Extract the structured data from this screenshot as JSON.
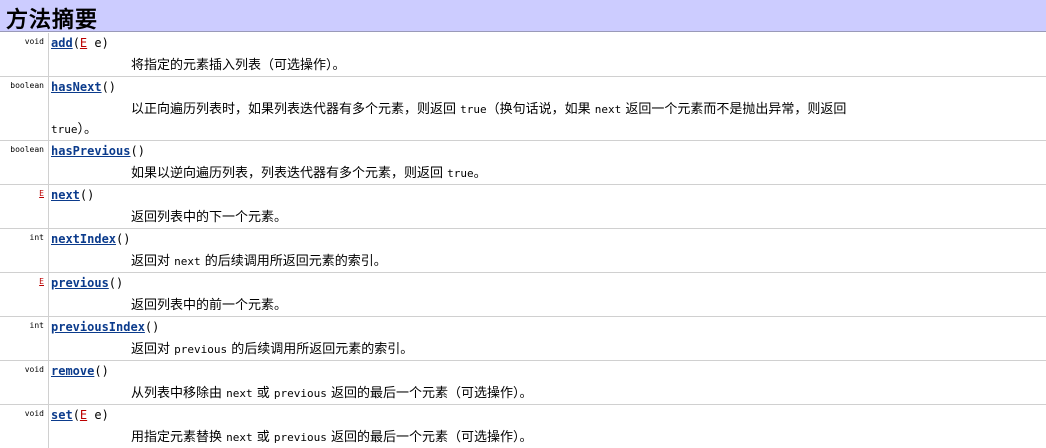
{
  "header": {
    "title": "方法摘要"
  },
  "methods": [
    {
      "ret": "void",
      "name": "add",
      "p_open": "(",
      "tparam": "E",
      "p_rest": " e)",
      "desc": "将指定的元素插入列表（可选操作）。"
    },
    {
      "ret": "boolean",
      "name": "hasNext",
      "p_open": "()",
      "desc_a": "以正向遍历列表时，如果列表迭代器有多个元素，则返回 ",
      "code_a": "true",
      "desc_b": "（换句话说，如果 ",
      "code_b": "next",
      "desc_c": " 返回一个元素而不是抛出异常，则返回",
      "line2_code": "true",
      "line2_text": "）。"
    },
    {
      "ret": "boolean",
      "name": "hasPrevious",
      "p_open": "()",
      "desc_a": "如果以逆向遍历列表，列表迭代器有多个元素，则返回 ",
      "code_a": "true",
      "desc_b": "。"
    },
    {
      "ret": "E",
      "name": "next",
      "p_open": "()",
      "desc": "返回列表中的下一个元素。"
    },
    {
      "ret": "int",
      "name": "nextIndex",
      "p_open": "()",
      "desc_a": "返回对 ",
      "code_a": "next",
      "desc_b": " 的后续调用所返回元素的索引。"
    },
    {
      "ret": "E",
      "name": "previous",
      "p_open": "()",
      "desc": "返回列表中的前一个元素。"
    },
    {
      "ret": "int",
      "name": "previousIndex",
      "p_open": "()",
      "desc_a": "返回对 ",
      "code_a": "previous",
      "desc_b": " 的后续调用所返回元素的索引。"
    },
    {
      "ret": "void",
      "name": "remove",
      "p_open": "()",
      "desc_a": "从列表中移除由 ",
      "code_a": "next",
      "desc_b": " 或 ",
      "code_b": "previous",
      "desc_c": " 返回的最后一个元素（可选操作）。"
    },
    {
      "ret": "void",
      "name": "set",
      "p_open": "(",
      "tparam": "E",
      "p_rest": " e)",
      "desc_a": "用指定元素替换 ",
      "code_a": "next",
      "desc_b": " 或 ",
      "code_b": "previous",
      "desc_c": " 返回的最后一个元素（可选操作）。"
    }
  ]
}
